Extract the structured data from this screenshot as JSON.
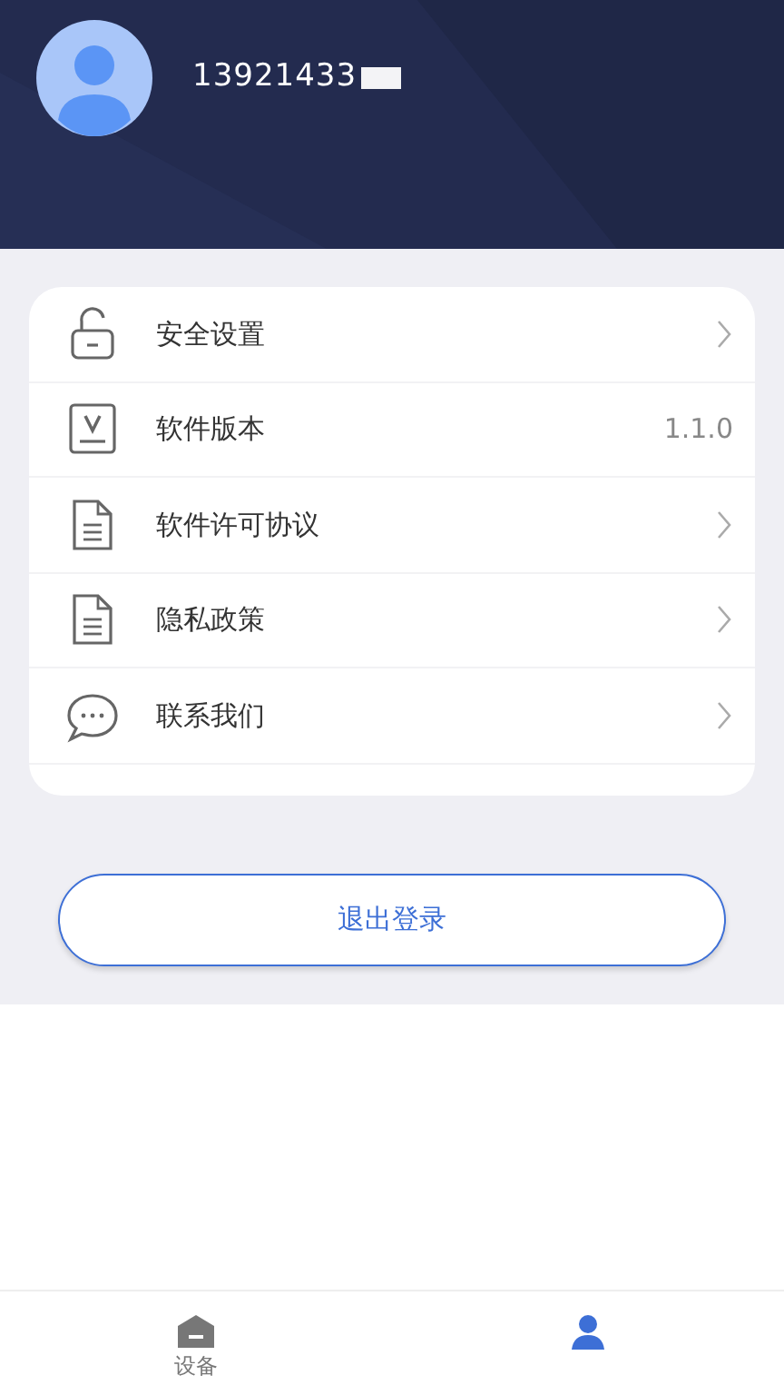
{
  "profile": {
    "phone": "13921433",
    "masked": true
  },
  "menu": [
    {
      "kind": "lock",
      "label": "安全设置",
      "arrow": true
    },
    {
      "kind": "version",
      "label": "软件版本",
      "value": "1.1.0",
      "arrow": false
    },
    {
      "kind": "document",
      "label": "软件许可协议",
      "arrow": true
    },
    {
      "kind": "document",
      "label": "隐私政策",
      "arrow": true
    },
    {
      "kind": "chat",
      "label": "联系我们",
      "arrow": true
    }
  ],
  "logout_button": "退出登录",
  "bottom_nav": [
    {
      "kind": "device",
      "label": "设备",
      "selected": false
    },
    {
      "kind": "person",
      "selected": true
    }
  ]
}
